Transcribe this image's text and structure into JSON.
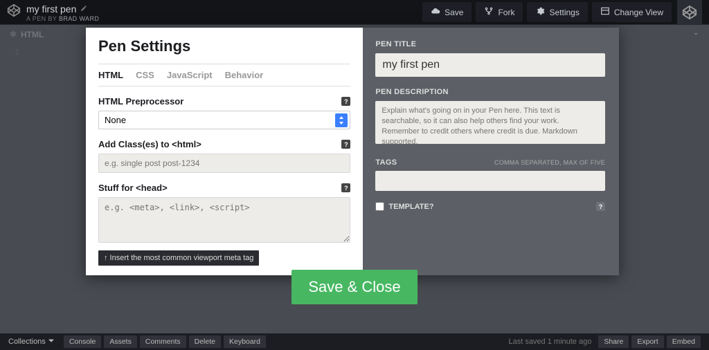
{
  "header": {
    "pen_title": "my first pen",
    "subtitle_prefix": "A PEN BY",
    "author": "Brad Ward",
    "buttons": {
      "save": "Save",
      "fork": "Fork",
      "settings": "Settings",
      "change_view": "Change View"
    }
  },
  "panel": {
    "label": "HTML",
    "line_number": "1"
  },
  "modal": {
    "title": "Pen Settings",
    "tabs": {
      "html": "HTML",
      "css": "CSS",
      "js": "JavaScript",
      "behavior": "Behavior"
    },
    "preprocessor": {
      "label": "HTML Preprocessor",
      "value": "None"
    },
    "add_classes": {
      "label": "Add Class(es) to <html>",
      "placeholder": "e.g. single post post-1234"
    },
    "stuff_head": {
      "label": "Stuff for <head>",
      "placeholder": "e.g. <meta>, <link>, <script>"
    },
    "viewport_hint": "↑ Insert the most common viewport meta tag",
    "right": {
      "pen_title_label": "PEN TITLE",
      "pen_title_value": "my first pen",
      "description_label": "PEN DESCRIPTION",
      "description_placeholder": "Explain what's going on in your Pen here. This text is searchable, so it can also help others find your work. Remember to credit others where credit is due. Markdown supported.",
      "tags_label": "TAGS",
      "tags_hint": "COMMA SEPARATED, MAX OF FIVE",
      "template_label": "TEMPLATE?"
    },
    "save_close": "Save & Close"
  },
  "footer": {
    "collections": "Collections",
    "console": "Console",
    "assets": "Assets",
    "comments": "Comments",
    "delete": "Delete",
    "keyboard": "Keyboard",
    "last_saved": "Last saved 1 minute ago",
    "share": "Share",
    "export": "Export",
    "embed": "Embed"
  }
}
